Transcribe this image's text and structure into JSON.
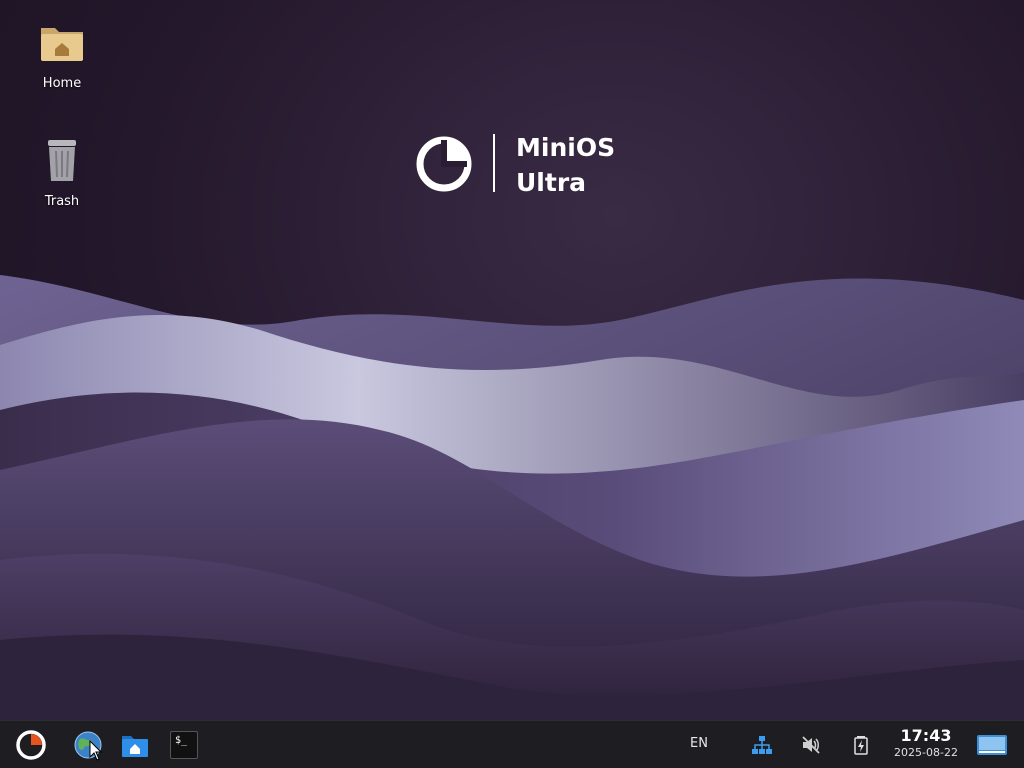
{
  "desktop": {
    "icons": [
      {
        "label": "Home"
      },
      {
        "label": "Trash"
      }
    ],
    "brand": {
      "line1": "MiniOS",
      "line2": "Ultra"
    }
  },
  "taskbar": {
    "launchers": [
      {
        "icon": "minios-menu-icon"
      },
      {
        "icon": "web-browser-icon"
      },
      {
        "icon": "home-folder-icon"
      },
      {
        "icon": "terminal-icon"
      }
    ],
    "terminal_glyph": "$_",
    "tray": {
      "language": "EN",
      "network_icon": "network-icon",
      "volume_icon": "volume-muted-icon",
      "battery_icon": "battery-charging-icon"
    },
    "clock": {
      "time": "17:43",
      "date": "2025-08-22"
    }
  },
  "colors": {
    "taskbar_bg": "#1e1e22",
    "accent": "#e8531e",
    "folder_blue": "#2f8fe8"
  }
}
